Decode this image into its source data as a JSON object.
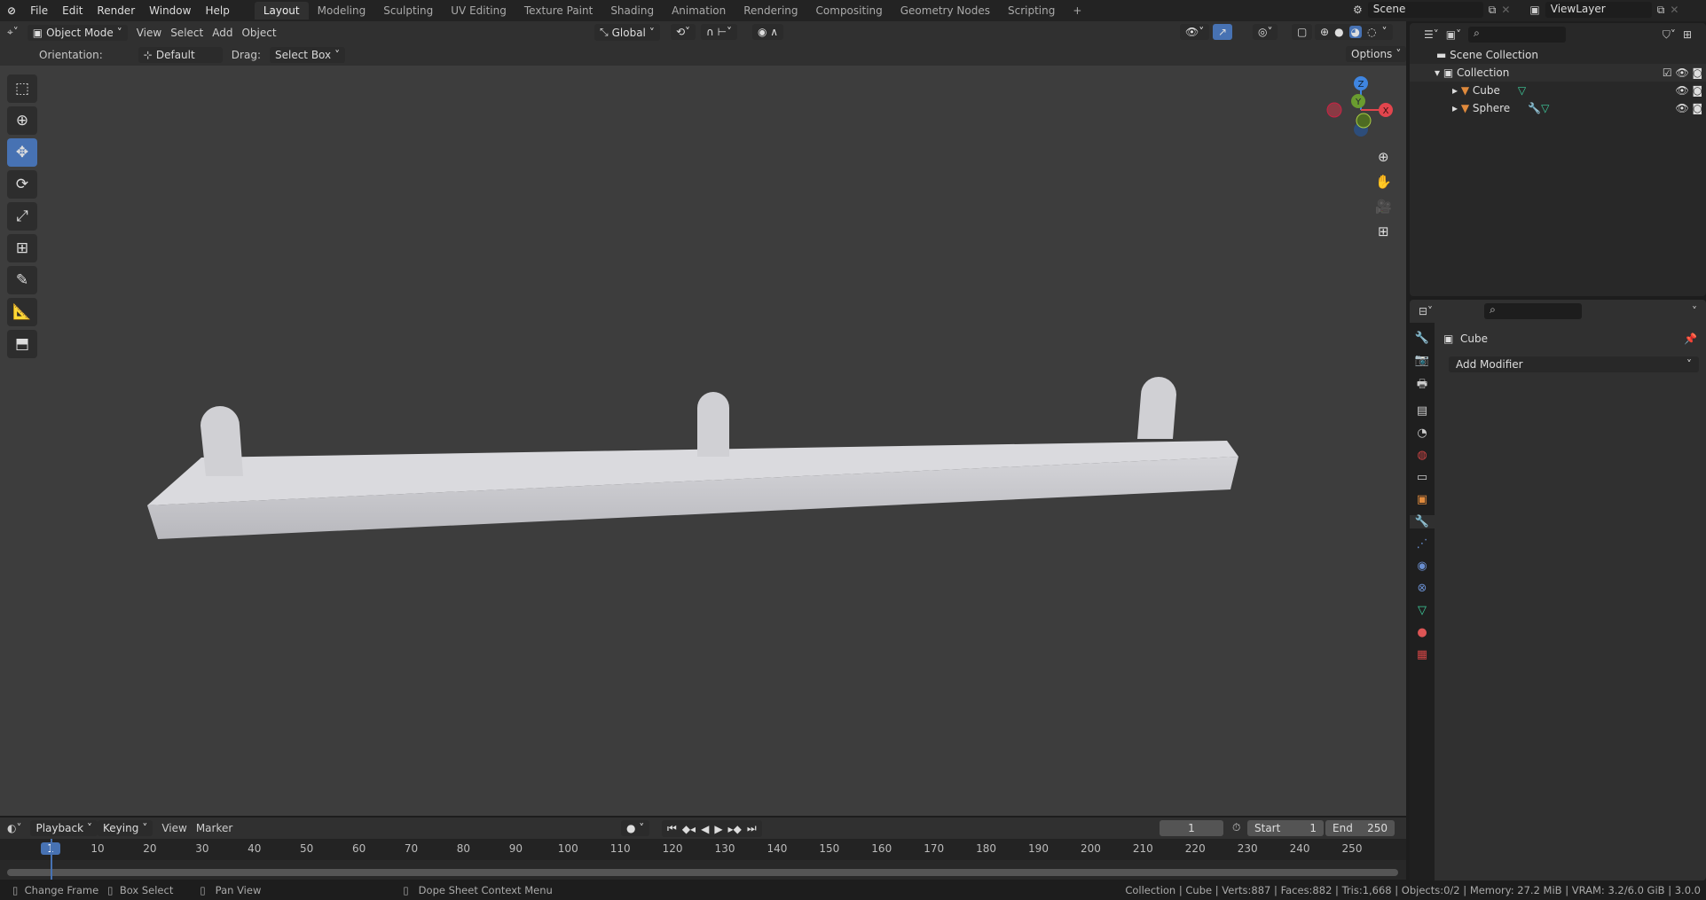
{
  "menu": [
    "File",
    "Edit",
    "Render",
    "Window",
    "Help"
  ],
  "workspaces": [
    "Layout",
    "Modeling",
    "Sculpting",
    "UV Editing",
    "Texture Paint",
    "Shading",
    "Animation",
    "Rendering",
    "Compositing",
    "Geometry Nodes",
    "Scripting"
  ],
  "active_workspace": "Layout",
  "scene": "Scene",
  "view_layer": "ViewLayer",
  "header": {
    "mode": "Object Mode",
    "menus": [
      "View",
      "Select",
      "Add",
      "Object"
    ],
    "transform_orientation": "Global",
    "options": "Options"
  },
  "tool_settings": {
    "orientation_label": "Orientation:",
    "orientation": "Default",
    "drag_label": "Drag:",
    "drag": "Select Box"
  },
  "gizmo": {
    "x": "X",
    "y": "Y",
    "z": "Z",
    "colors": {
      "x": "#e2454d",
      "y": "#6a9c2f",
      "z": "#3f85e0"
    }
  },
  "outliner": {
    "root": "Scene Collection",
    "collection": "Collection",
    "objects": [
      "Cube",
      "Sphere"
    ]
  },
  "properties": {
    "object": "Cube",
    "add_modifier": "Add Modifier"
  },
  "timeline": {
    "menus": [
      "Playback",
      "Keying",
      "View",
      "Marker"
    ],
    "current_frame": "1",
    "start_label": "Start",
    "start": "1",
    "end_label": "End",
    "end": "250",
    "ticks": [
      "1",
      "10",
      "20",
      "30",
      "40",
      "50",
      "60",
      "70",
      "80",
      "90",
      "100",
      "110",
      "120",
      "130",
      "140",
      "150",
      "160",
      "170",
      "180",
      "190",
      "200",
      "210",
      "220",
      "230",
      "240",
      "250"
    ]
  },
  "status": {
    "hints": [
      "Change Frame",
      "Box Select",
      "Pan View",
      "Dope Sheet Context Menu"
    ],
    "stats": "Collection | Cube | Verts:887 | Faces:882 | Tris:1,668 | Objects:0/2 | Memory: 27.2 MiB | VRAM: 3.2/6.0 GiB | 3.0.0"
  },
  "accent": "#4772b3"
}
